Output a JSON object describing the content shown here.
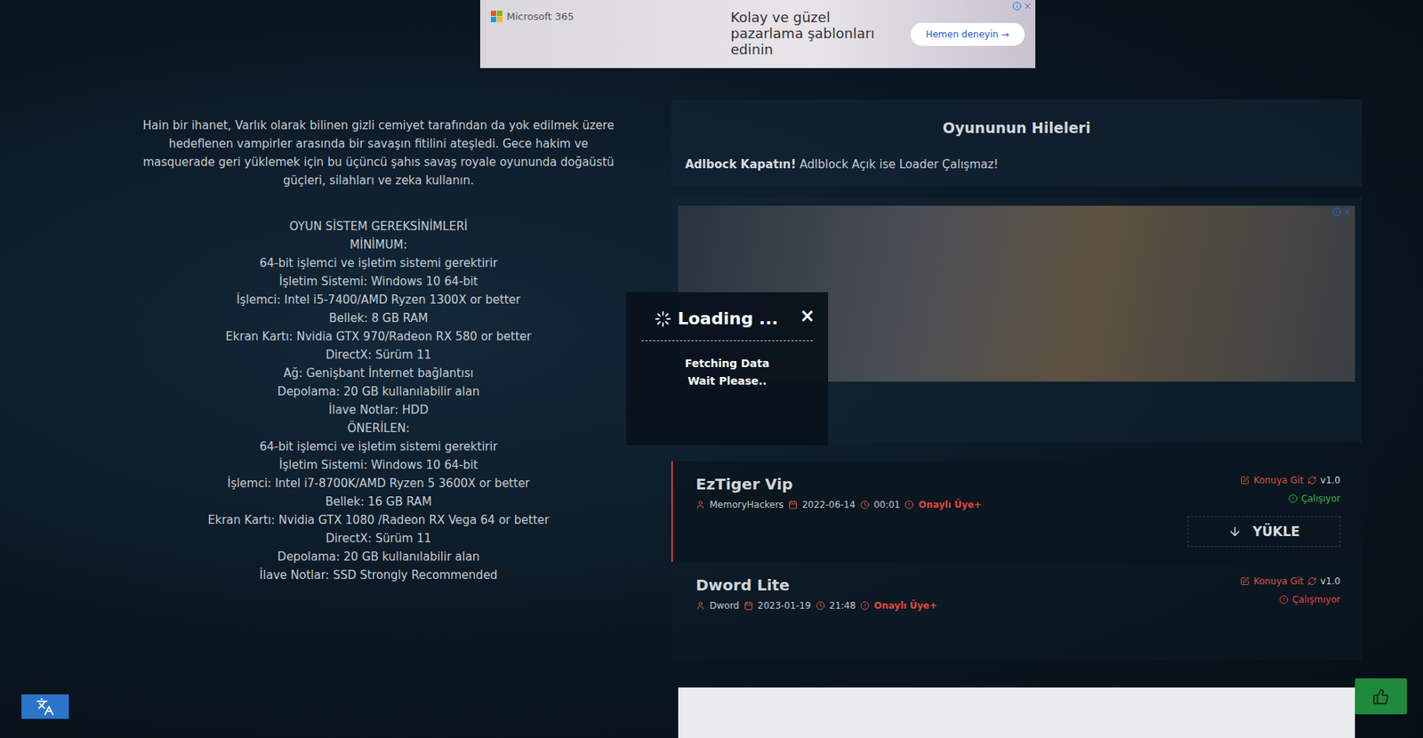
{
  "top_ad": {
    "brand": "Microsoft 365",
    "text": "Kolay ve güzel pazarlama şablonları edinin",
    "cta": "Hemen deneyin →"
  },
  "description": "Hain bir ihanet, Varlık olarak bilinen gizli cemiyet tarafından da yok edilmek üzere hedeflenen vampirler arasında bir savaşın fitilini ateşledi. Gece hakim ve masquerade geri yüklemek için bu üçüncü şahıs savaş royale oyununda doğaüstü güçleri, silahları ve zeka kullanın.",
  "requirements": {
    "title": "OYUN SİSTEM GEREKSİNİMLERİ",
    "groups": [
      {
        "title": "MİNİMUM:",
        "lines": [
          "64-bit işlemci ve işletim sistemi gerektirir",
          "İşletim Sistemi: Windows 10 64-bit",
          "İşlemci: Intel i5-7400/AMD Ryzen 1300X or better",
          "Bellek: 8 GB RAM",
          "Ekran Kartı: Nvidia GTX 970/Radeon RX 580 or better",
          "DirectX: Sürüm 11",
          "Ağ: Genişbant İnternet bağlantısı",
          "Depolama: 20 GB kullanılabilir alan",
          "İlave Notlar: HDD"
        ]
      },
      {
        "title": "ÖNERİLEN:",
        "lines": [
          "64-bit işlemci ve işletim sistemi gerektirir",
          "İşletim Sistemi: Windows 10 64-bit",
          "İşlemci: Intel i7-8700K/AMD Ryzen 5 3600X or better",
          "Bellek: 16 GB RAM",
          "Ekran Kartı: Nvidia GTX 1080 /Radeon RX Vega 64 or better",
          "DirectX: Sürüm 11",
          "Depolama: 20 GB kullanılabilir alan",
          "İlave Notlar: SSD Strongly Recommended"
        ]
      }
    ]
  },
  "cheats_panel": {
    "title": "Oyununun Hileleri",
    "notice_bold": "Adlbock Kapatın!",
    "notice": "Adlblock Açık ise Loader Çalışmaz!"
  },
  "cheats": [
    {
      "name": "EzTiger Vip",
      "author": "MemoryHackers",
      "date": "2022-06-14",
      "time": "00:01",
      "rank": "Onaylı Üye+",
      "link": "Konuya Git",
      "version": "v1.0",
      "status": "Çalışıyor",
      "color": "#3cb04a",
      "selected": true,
      "button": "YÜKLE"
    },
    {
      "name": "Dword Lite",
      "author": "Dword",
      "date": "2023-01-19",
      "time": "21:48",
      "rank": "Onaylı Üye+",
      "link": "Konuya Git",
      "version": "v1.0",
      "status": "Çalışmıyor",
      "color": "#e0473a",
      "selected": false
    }
  ],
  "loading": {
    "title": "Loading ...",
    "close": "×",
    "lines": [
      "Fetching Data",
      "Wait Please.."
    ]
  }
}
